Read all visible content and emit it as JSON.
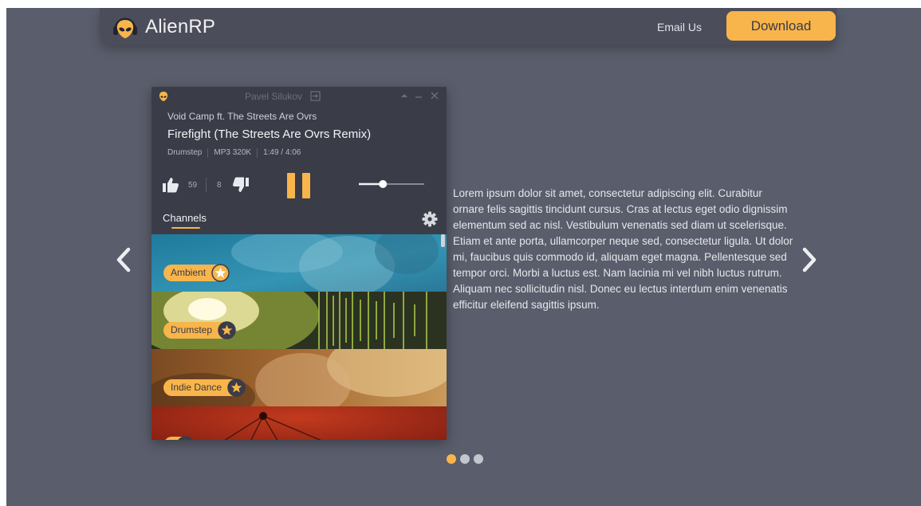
{
  "brand": {
    "name": "AlienRP",
    "logo_icon": "alien-headphones-icon"
  },
  "nav": {
    "email_label": "Email Us",
    "download_label": "Download"
  },
  "colors": {
    "accent": "#f8b54b",
    "background": "#5a5d6b",
    "header": "#4b4d5b",
    "player": "#3a3c48"
  },
  "player": {
    "user": "Pavel Silukov",
    "artist": "Void Camp ft. The Streets Are Ovrs",
    "track": "Firefight (The Streets Are Ovrs Remix)",
    "meta": {
      "genre": "Drumstep",
      "quality": "MP3 320K",
      "time": "1:49 / 4:06"
    },
    "likes": "59",
    "dislikes": "8",
    "volume_level": 0.35,
    "channels_label": "Channels",
    "channels": [
      {
        "name": "Ambient"
      },
      {
        "name": "Drumstep"
      },
      {
        "name": "Indie Dance"
      },
      {
        "name": ""
      }
    ]
  },
  "description": "Lorem ipsum dolor sit amet, consectetur adipiscing elit. Curabitur ornare felis sagittis tincidunt cursus. Cras at lectus eget odio dignissim elementum sed ac nisl. Vestibulum venenatis sed diam ut scelerisque. Etiam et ante porta, ullamcorper neque sed, consectetur ligula. Ut dolor mi, faucibus quis commodo id, aliquam eget magna. Pellentesque sed tempor orci. Morbi a luctus est. Nam lacinia mi vel nibh luctus rutrum. Aliquam nec sollicitudin nisl. Donec eu lectus interdum enim venenatis efficitur eleifend sagittis ipsum.",
  "carousel": {
    "slide_count": 3,
    "active_index": 0
  }
}
